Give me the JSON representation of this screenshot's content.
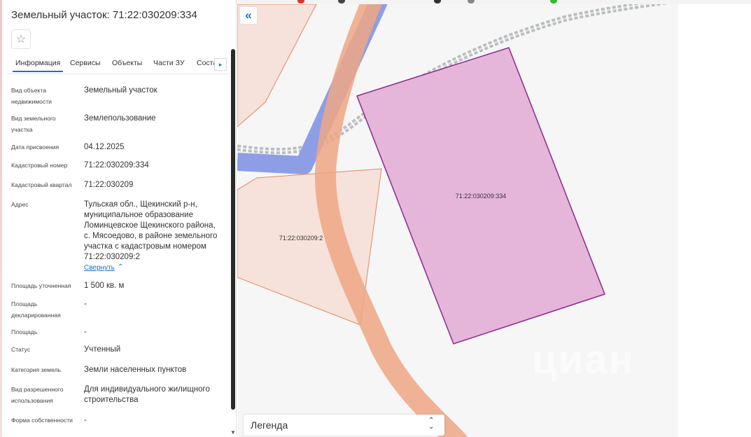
{
  "panel": {
    "title": "Земельный участок: 71:22:030209:334",
    "star_symbol": "☆",
    "tabs": [
      "Информация",
      "Сервисы",
      "Объекты",
      "Части ЗУ",
      "Соста"
    ],
    "tab_arrow": "▸",
    "fields": [
      {
        "label": "Вид объекта недвижимости",
        "value": "Земельный участок"
      },
      {
        "label": "Вид земельного участка",
        "value": "Землепользование"
      },
      {
        "label": "Дата присвоения",
        "value": "04.12.2025"
      },
      {
        "label": "Кадастровый номер",
        "value": "71:22:030209:334"
      },
      {
        "label": "Кадастровый квартал",
        "value": "71:22:030209"
      },
      {
        "label": "Адрес",
        "value": "Тульская обл., Щекинский р-н, муниципальное образование Ломинцевское Щекинского района, с. Мясоедово, в районе земельного участка с кадастровым номером 71:22:030209:2"
      },
      {
        "label": "Площадь уточненная",
        "value": "1 500 кв. м"
      },
      {
        "label": "Площадь декларированная",
        "value": "-"
      },
      {
        "label": "Площадь",
        "value": "-"
      },
      {
        "label": "Статус",
        "value": "Учтенный"
      },
      {
        "label": "Категория земель",
        "value": "Земли населенных пунктов"
      },
      {
        "label": "Вид разрешенного использования",
        "value": "Для индивидуального жилищного строительства"
      },
      {
        "label": "Форма собственности",
        "value": "-"
      }
    ],
    "collapse_link": "Свернуть",
    "collapse_chevron": "⌃"
  },
  "map": {
    "collapse_symbol": "«",
    "parcel_main_label": "71:22:030209:334",
    "parcel_neighbor_label": "71:22:030209:2",
    "legend_label": "Легенда",
    "legend_toggle": "⌃⌄",
    "watermark": "циан",
    "colors": {
      "parcel_main_fill": "#e6b5da",
      "parcel_main_stroke": "#8a2a8c",
      "parcel_neighbor_fill": "#f6ddd3",
      "parcel_neighbor_stroke": "#e2875e",
      "road_orange": "#efa684",
      "road_blue": "#8e9ee6"
    }
  }
}
